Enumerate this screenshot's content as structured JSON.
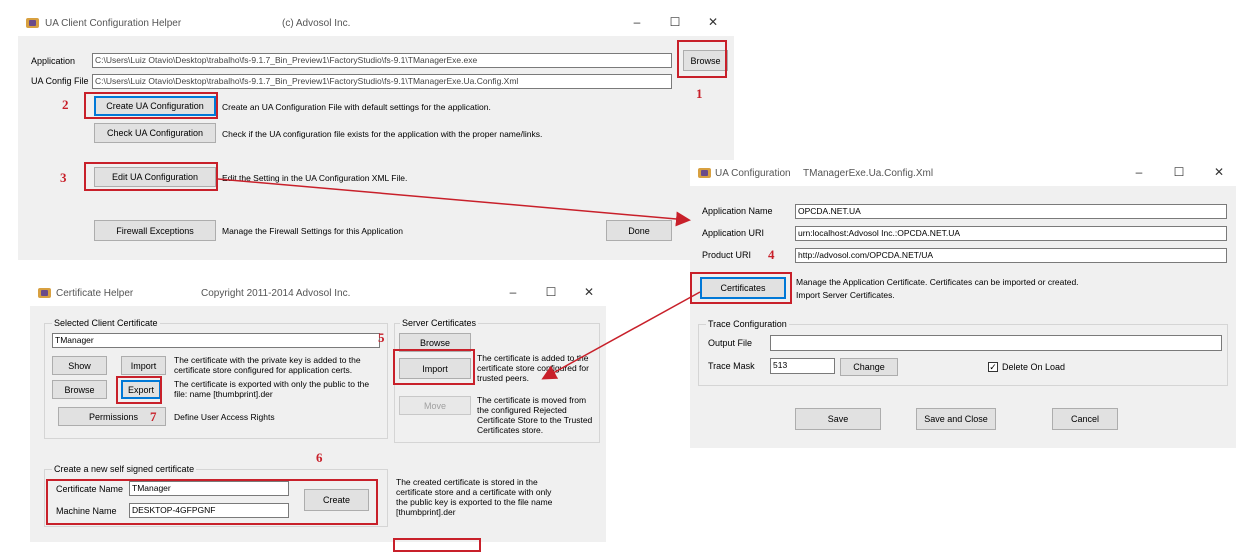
{
  "main_window": {
    "title": "UA Client Configuration Helper",
    "copyright": "(c) Advosol Inc.",
    "application_label": "Application",
    "application_value": "C:\\Users\\Luiz Otavio\\Desktop\\trabalho\\fs-9.1.7_Bin_Preview1\\FactoryStudio\\fs-9.1\\TManagerExe.exe",
    "config_file_label": "UA Config File",
    "config_file_value": "C:\\Users\\Luiz Otavio\\Desktop\\trabalho\\fs-9.1.7_Bin_Preview1\\FactoryStudio\\fs-9.1\\TManagerExe.Ua.Config.Xml",
    "browse_label": "Browse",
    "create_label": "Create UA Configuration",
    "create_desc": "Create an UA Configuration File with default settings for the application.",
    "check_label": "Check UA Configuration",
    "check_desc": "Check if the UA configuration file exists for the application with the proper name/links.",
    "edit_label": "Edit UA Configuration",
    "edit_desc": "Edit the Setting in the UA Configuration XML File.",
    "firewall_label": "Firewall Exceptions",
    "firewall_desc": "Manage the Firewall Settings for this Application",
    "done_label": "Done"
  },
  "ua_config_window": {
    "title": "UA Configuration",
    "file": "TManagerExe.Ua.Config.Xml",
    "app_name_label": "Application Name",
    "app_name_value": "OPCDA.NET.UA",
    "app_uri_label": "Application URI",
    "app_uri_value": "urn:localhost:Advosol Inc.:OPCDA.NET.UA",
    "product_uri_label": "Product URI",
    "product_uri_value": "http://advosol.com/OPCDA.NET/UA",
    "certificates_label": "Certificates",
    "cert_desc_1": "Manage the Application Certificate.  Certificates can be imported or created.",
    "cert_desc_2": "Import Server Certificates.",
    "trace_group": "Trace Configuration",
    "output_file_label": "Output File",
    "output_file_value": "",
    "trace_mask_label": "Trace Mask",
    "trace_mask_value": "513",
    "change_label": "Change",
    "delete_on_load_label": "Delete On Load",
    "save_label": "Save",
    "save_close_label": "Save and Close",
    "cancel_label": "Cancel"
  },
  "cert_window": {
    "title": "Certificate Helper",
    "copyright": "Copyright 2011-2014 Advosol Inc.",
    "selected_group": "Selected Client Certificate",
    "selected_value": "TManager",
    "show_label": "Show",
    "import_label": "Import",
    "import_desc": "The certificate with the private key is added to the certificate store configured for application certs.",
    "browse_label": "Browse",
    "export_label": "Export",
    "export_desc": "The certificate is exported with only the public to the file:   name [thumbprint].der",
    "permissions_label": "Permissions",
    "permissions_desc": "Define User Access Rights",
    "server_group": "Server Certificates",
    "server_browse_label": "Browse",
    "server_import_label": "Import",
    "server_import_desc": "The certificate is added to the certificate store configured for trusted peers.",
    "move_label": "Move",
    "move_desc": "The certificate is moved from the configured Rejected Certificate Store to the Trusted Certificates store.",
    "new_group": "Create a new self signed certificate",
    "cert_name_label": "Certificate Name",
    "cert_name_value": "TManager",
    "machine_name_label": "Machine Name",
    "machine_name_value": "DESKTOP-4GFPGNF",
    "create_label": "Create",
    "create_desc": "The created certificate is stored in the certificate store and a certificate with only the public key is exported to the file  name [thumbprint].der"
  },
  "annotations": {
    "n1": "1",
    "n2": "2",
    "n3": "3",
    "n4": "4",
    "n5": "5",
    "n6": "6",
    "n7": "7",
    "color": "#c8202a"
  }
}
